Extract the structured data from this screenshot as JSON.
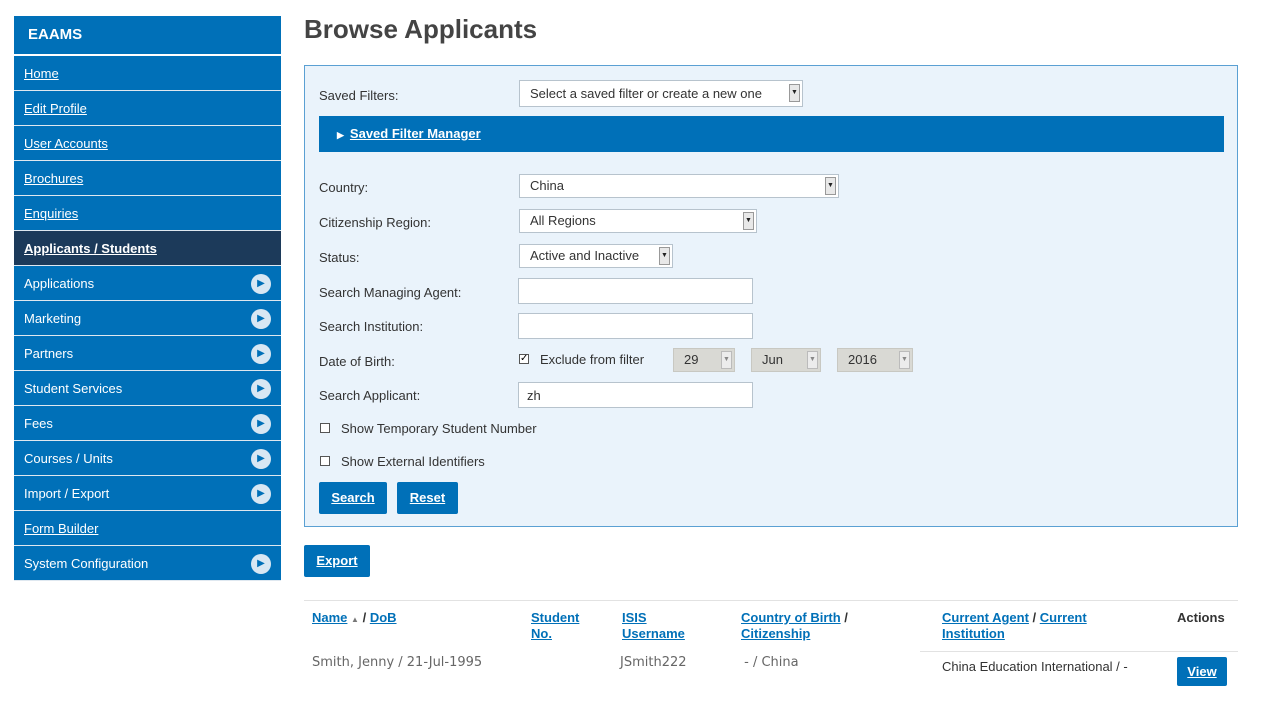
{
  "sidebar": {
    "title": "EAAMS",
    "items": [
      {
        "label": "Home",
        "kind": "link"
      },
      {
        "label": "Edit Profile",
        "kind": "link"
      },
      {
        "label": "User Accounts",
        "kind": "link"
      },
      {
        "label": "Brochures",
        "kind": "link"
      },
      {
        "label": "Enquiries",
        "kind": "link"
      },
      {
        "label": "Applicants / Students",
        "kind": "active"
      },
      {
        "label": "Applications",
        "kind": "expand"
      },
      {
        "label": "Marketing",
        "kind": "expand"
      },
      {
        "label": "Partners",
        "kind": "expand"
      },
      {
        "label": "Student Services",
        "kind": "expand"
      },
      {
        "label": "Fees",
        "kind": "expand"
      },
      {
        "label": "Courses / Units",
        "kind": "expand"
      },
      {
        "label": "Import / Export",
        "kind": "expand"
      },
      {
        "label": "Form Builder",
        "kind": "link"
      },
      {
        "label": "System Configuration",
        "kind": "expand"
      }
    ],
    "arrow_icon": "circle-arrow-right-icon"
  },
  "page": {
    "title": "Browse Applicants"
  },
  "filters": {
    "saved_filters_label": "Saved Filters:",
    "saved_filters_value": "Select a saved filter or create a new one",
    "filter_manager_label": "Saved Filter Manager",
    "country_label": "Country:",
    "country_value": "China",
    "region_label": "Citizenship Region:",
    "region_value": "All Regions",
    "status_label": "Status:",
    "status_value": "Active and Inactive",
    "managing_agent_label": "Search Managing Agent:",
    "managing_agent_value": "",
    "institution_label": "Search Institution:",
    "institution_value": "",
    "dob_label": "Date of Birth:",
    "dob_exclude_label": "Exclude from filter",
    "dob_exclude_checked": true,
    "dob_day": "29",
    "dob_month": "Jun",
    "dob_year": "2016",
    "applicant_label": "Search Applicant:",
    "applicant_value": "zh",
    "temp_number_label": "Show Temporary Student Number",
    "external_ids_label": "Show External Identifiers",
    "search_button": "Search",
    "reset_button": "Reset"
  },
  "export_button": "Export",
  "table": {
    "headers": {
      "name": "Name",
      "sort_icon": "sort-ascending-icon",
      "name_sep": " / ",
      "dob": "DoB",
      "student_no_1": "Student",
      "student_no_2": "No.",
      "isis_1": "ISIS",
      "isis_2": "Username",
      "cob_1": "Country of Birth",
      "cob_sep": " /",
      "cob_2": "Citizenship",
      "agent_1": "Current Agent",
      "agent_sep": " / ",
      "agent_2": "Current",
      "agent_3": "Institution",
      "actions": "Actions"
    },
    "rows": [
      {
        "name_dob": "Smith, Jenny / 21-Jul-1995",
        "student_no": "",
        "isis_username": "JSmith222",
        "country": " - / China",
        "agent_institution": "China Education International / -",
        "action": "View"
      }
    ]
  },
  "colors": {
    "primary": "#0070b8",
    "active_nav": "#1c3a5a",
    "panel_bg": "#eaf3fb"
  }
}
